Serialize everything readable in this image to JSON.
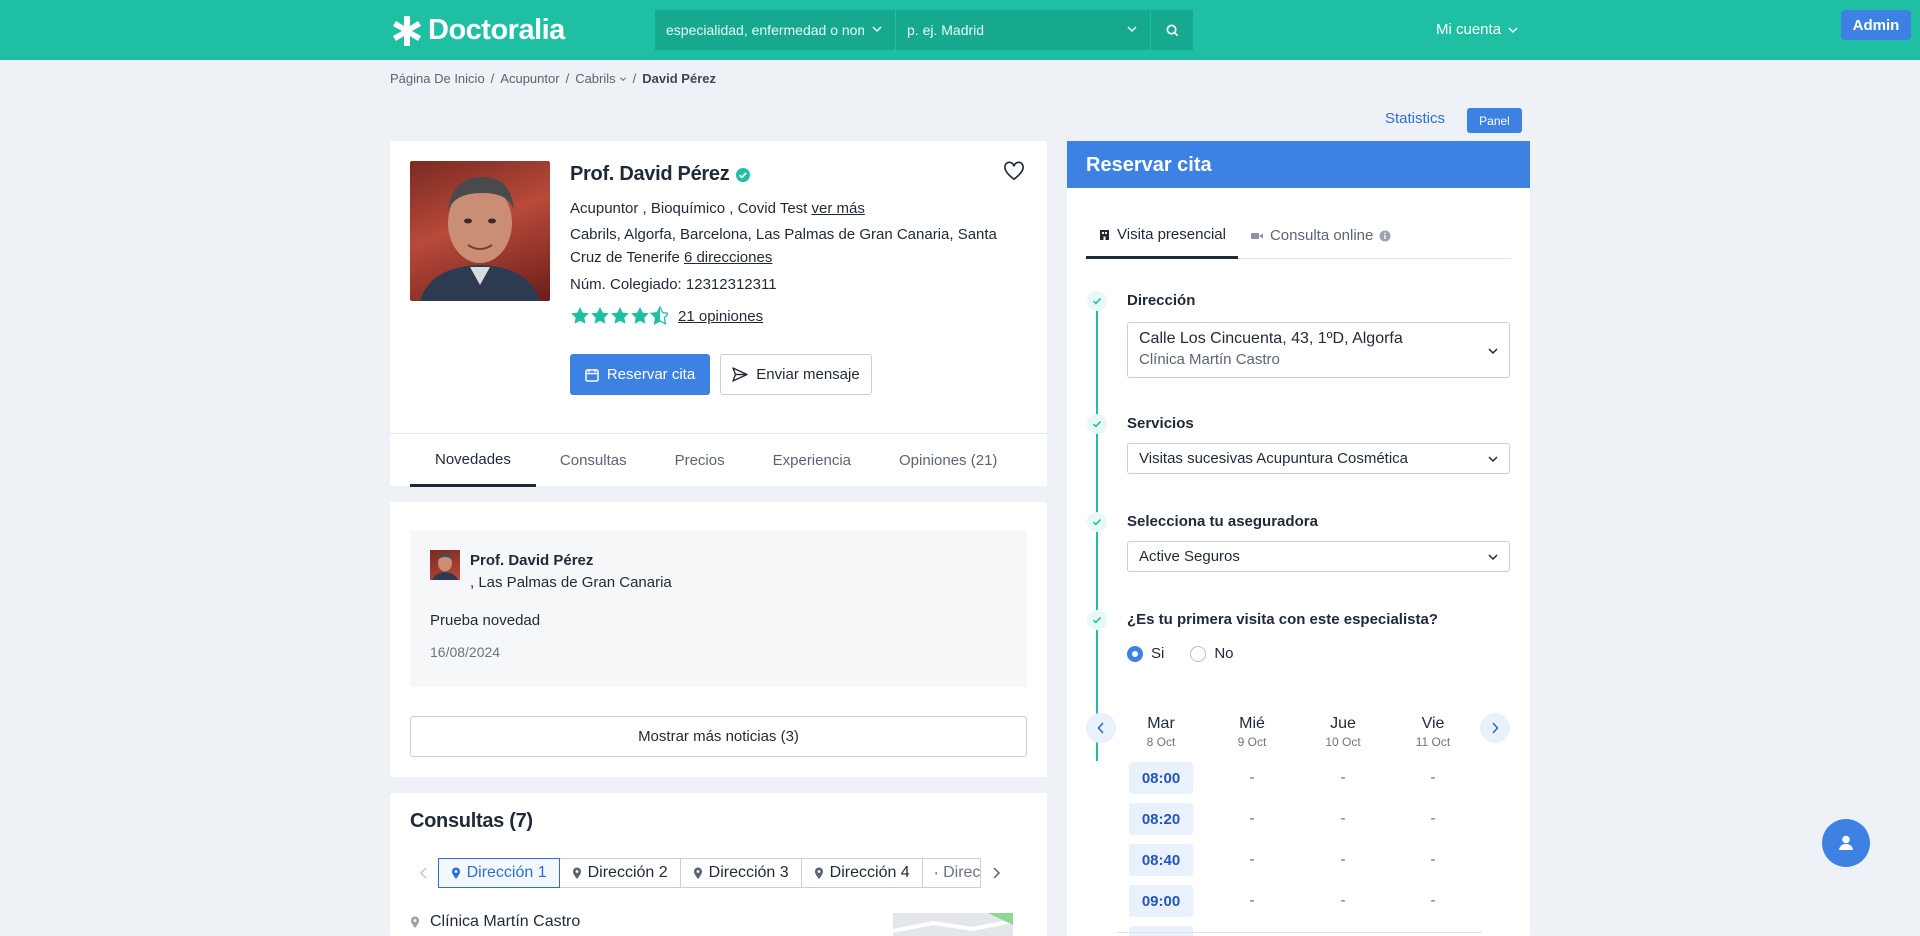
{
  "header": {
    "logo_text": "Doctoralia",
    "search_placeholder": "especialidad, enfermedad o nombre",
    "location_placeholder": "p. ej. Madrid",
    "account_label": "Mi cuenta",
    "admin_label": "Admin"
  },
  "breadcrumb": {
    "items": [
      "Página De Inicio",
      "Acupuntor",
      "Cabrils",
      "David Pérez"
    ],
    "separator": "/"
  },
  "toolbar": {
    "statistics_label": "Statistics",
    "panel_label": "Panel"
  },
  "profile": {
    "name": "Prof. David Pérez",
    "specialties": "Acupuntor , Bioquímico , Covid Test ",
    "see_more": "ver más",
    "locations": "Cabrils, Algorfa, Barcelona, Las Palmas de Gran Canaria, Santa",
    "locations_2": "Cruz de Tenerife ",
    "addresses_link": "6 direcciones",
    "license": "Núm. Colegiado: 12312312311",
    "rating_stars": 4.5,
    "reviews_link": "21 opiniones",
    "book_button": "Reservar cita",
    "message_button": "Enviar mensaje",
    "tabs": [
      "Novedades",
      "Consultas",
      "Precios",
      "Experiencia",
      "Opiniones (21)"
    ]
  },
  "news": {
    "author": "Prof. David Pérez",
    "location": ", Las Palmas de Gran Canaria",
    "text": "Prueba novedad",
    "date": "16/08/2024",
    "more_button": "Mostrar más noticias (3)"
  },
  "consultas": {
    "title": "Consultas (7)",
    "tabs": [
      "Dirección 1",
      "Dirección 2",
      "Dirección 3",
      "Dirección 4",
      "Direc"
    ],
    "clinic_name": "Clínica Martín Castro"
  },
  "booking": {
    "title": "Reservar cita",
    "tab_in_person": "Visita presencial",
    "tab_online": "Consulta online",
    "address_label": "Dirección",
    "address_value": "Calle Los Cincuenta, 43, 1ºD, Algorfa",
    "address_clinic": "Clínica Martín Castro",
    "services_label": "Servicios",
    "services_value": "Visitas sucesivas Acupuntura Cosmética",
    "insurer_label": "Selecciona tu aseguradora",
    "insurer_value": "Active Seguros",
    "first_visit_label": "¿Es tu primera visita con este especialista?",
    "radio_yes": "Si",
    "radio_no": "No",
    "first_visit_selected": "Si",
    "days": [
      {
        "name": "Mar",
        "date": "8 Oct"
      },
      {
        "name": "Mié",
        "date": "9 Oct"
      },
      {
        "name": "Jue",
        "date": "10 Oct"
      },
      {
        "name": "Vie",
        "date": "11 Oct"
      }
    ],
    "slots": [
      "08:00",
      "08:20",
      "08:40",
      "09:00"
    ],
    "empty_slot": "-"
  },
  "colors": {
    "brand": "#1fbfa3",
    "accent": "#3d82e3",
    "verified": "#1fbfa3"
  }
}
